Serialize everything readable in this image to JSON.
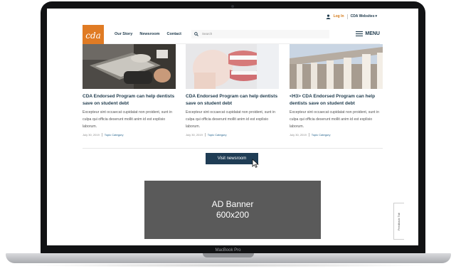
{
  "device": {
    "model_label": "MacBook Pro"
  },
  "utility_bar": {
    "login_label": "Log In",
    "sites_label": "CDA Websites",
    "user_icon": "user-icon",
    "chevron_icon": "chevron-down-icon"
  },
  "header": {
    "logo_text": "cda",
    "nav": [
      "Our Story",
      "Newsroom",
      "Contact"
    ],
    "search_placeholder": "Search",
    "menu_label": "MENU",
    "brand_color": "#e07b24",
    "nav_color": "#1e3a4c"
  },
  "cards": [
    {
      "title": "CDA Endorsed Program can help dentists save on student debt",
      "body": "Excepteur sint occaecat cupidatat non proident, sunt in culpa qui officia deserunt mollit anim id est explisio laborum.",
      "date": "July 30, 2019",
      "category": "Topic Category"
    },
    {
      "title": "CDA Endorsed Program can help dentists save on student debt",
      "body": "Excepteur sint occaecat cupidatat non proident, sunt in culpa qui officia deserunt mollit anim id est explisio laborum.",
      "date": "July 30, 2019",
      "category": "Topic Category"
    },
    {
      "title": "<H3> CDA Endorsed Program can help dentists save on student debt",
      "body": "Excepteur sint occaecat cupidatat non proident, sunt in culpa qui officia deserunt mollit anim id est explisio laborum.",
      "date": "July 30, 2019",
      "category": "Topic Category"
    }
  ],
  "visit_button": {
    "label": "Visit newsroom",
    "color": "#1f3d55"
  },
  "ad_banner": {
    "line1": "AD Banner",
    "line2": "600x200"
  },
  "feedback_tab": {
    "label": "Feedback Tab"
  }
}
